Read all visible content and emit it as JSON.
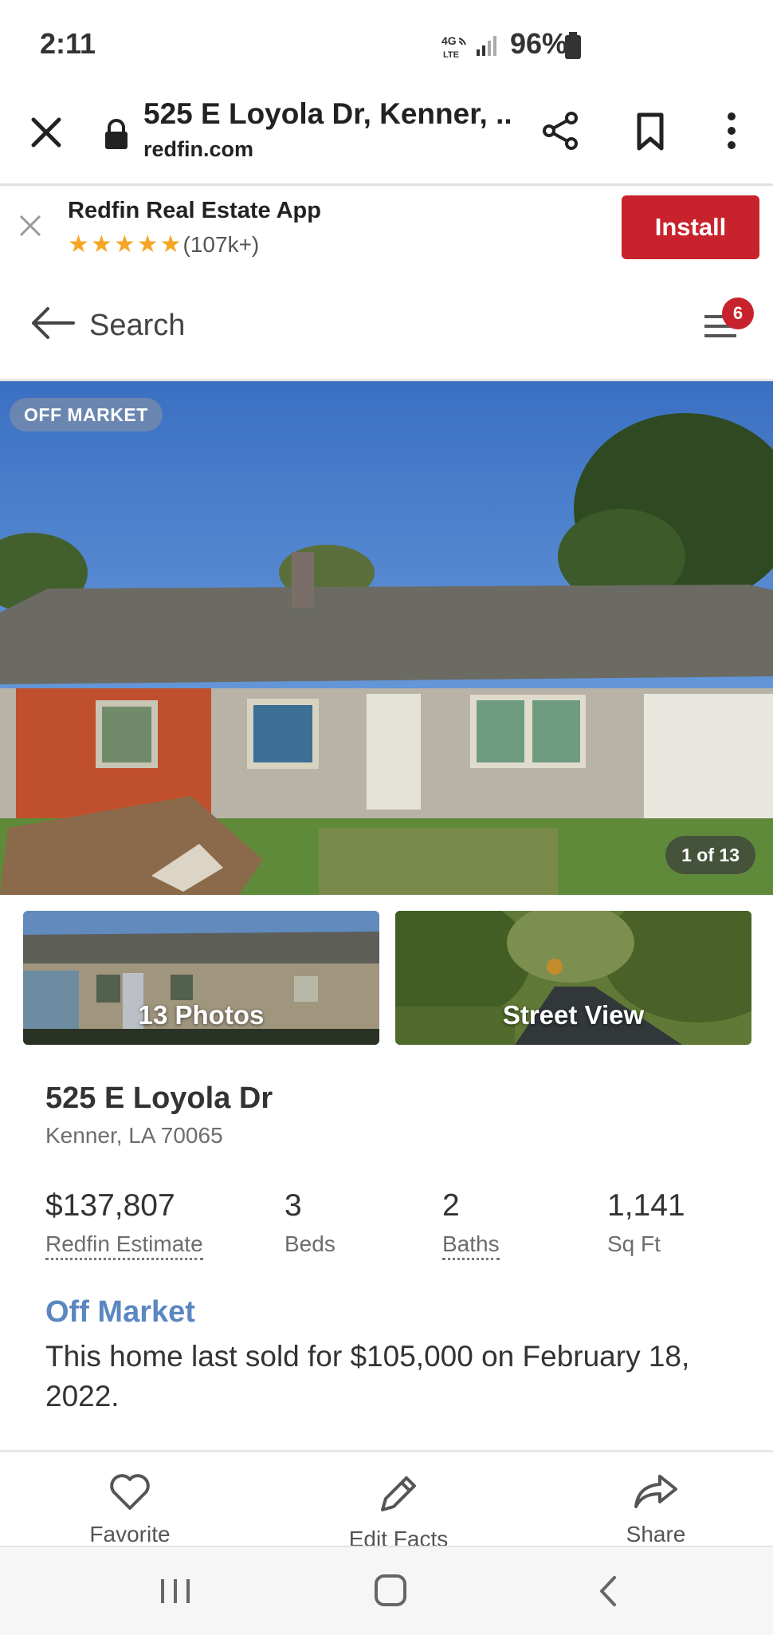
{
  "status_bar": {
    "time": "2:11",
    "network": "4G LTE",
    "battery": "96%"
  },
  "browser": {
    "title": "525 E Loyola Dr, Kenner, ...",
    "domain": "redfin.com"
  },
  "app_banner": {
    "name": "Redfin Real Estate App",
    "rating_count": "(107k+)",
    "stars": 5,
    "install_label": "Install"
  },
  "nav": {
    "search_label": "Search",
    "menu_badge": "6"
  },
  "hero": {
    "status_badge": "OFF MARKET",
    "counter": "1 of 13"
  },
  "thumbnails": {
    "photos_label": "13 Photos",
    "street_label": "Street View"
  },
  "property": {
    "address": "525 E Loyola Dr",
    "city": "Kenner, LA 70065",
    "stats": [
      {
        "value": "$137,807",
        "label": "Redfin Estimate"
      },
      {
        "value": "3",
        "label": "Beds"
      },
      {
        "value": "2",
        "label": "Baths"
      },
      {
        "value": "1,141",
        "label": "Sq Ft"
      }
    ],
    "status_title": "Off Market",
    "status_desc": "This home last sold for $105,000 on February 18, 2022."
  },
  "actions": [
    {
      "label": "Favorite",
      "icon": "heart-icon"
    },
    {
      "label": "Edit Facts",
      "icon": "pencil-icon"
    },
    {
      "label": "Share",
      "icon": "share-arrow-icon"
    }
  ],
  "colors": {
    "brand_red": "#c8232c",
    "status_blue": "#5b87c1",
    "star": "#f5a623"
  }
}
